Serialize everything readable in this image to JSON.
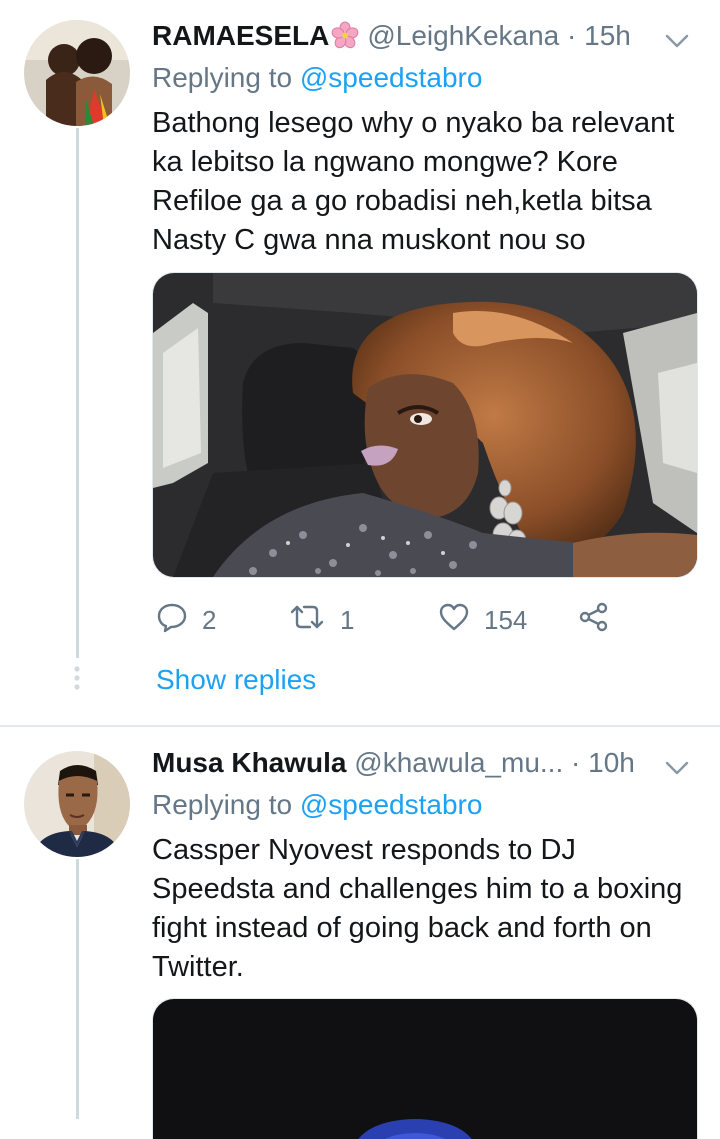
{
  "tweets": [
    {
      "name": "RAMAESELA",
      "name_emoji": "cherry-blossom-icon",
      "handle": "@LeighKekana",
      "dot": "·",
      "time": "15h",
      "replying_prefix": "Replying to",
      "replying_to": "@speedstabro",
      "lines": [
        "Bathong lesego why o nyako ba relevant",
        "ka lebitso la ngwano mongwe? Kore",
        "Refiloe ga a go robadisi neh,ketla bitsa",
        "Nasty C gwa nna muskont nou so"
      ],
      "stats": {
        "replies": "2",
        "retweets": "1",
        "likes": "154"
      },
      "show_replies": "Show replies"
    },
    {
      "name": "Musa Khawula",
      "handle": "@khawula_mu...",
      "dot": "·",
      "time": "10h",
      "replying_prefix": "Replying to",
      "replying_to": "@speedstabro",
      "lines": [
        "Cassper Nyovest responds to DJ",
        "Speedsta and challenges him to a boxing",
        "fight instead of going back and forth on",
        "Twitter."
      ]
    }
  ],
  "colors": {
    "link": "#1da1f2",
    "muted": "#657786",
    "text": "#14171a",
    "divider": "#e1e8ed"
  }
}
